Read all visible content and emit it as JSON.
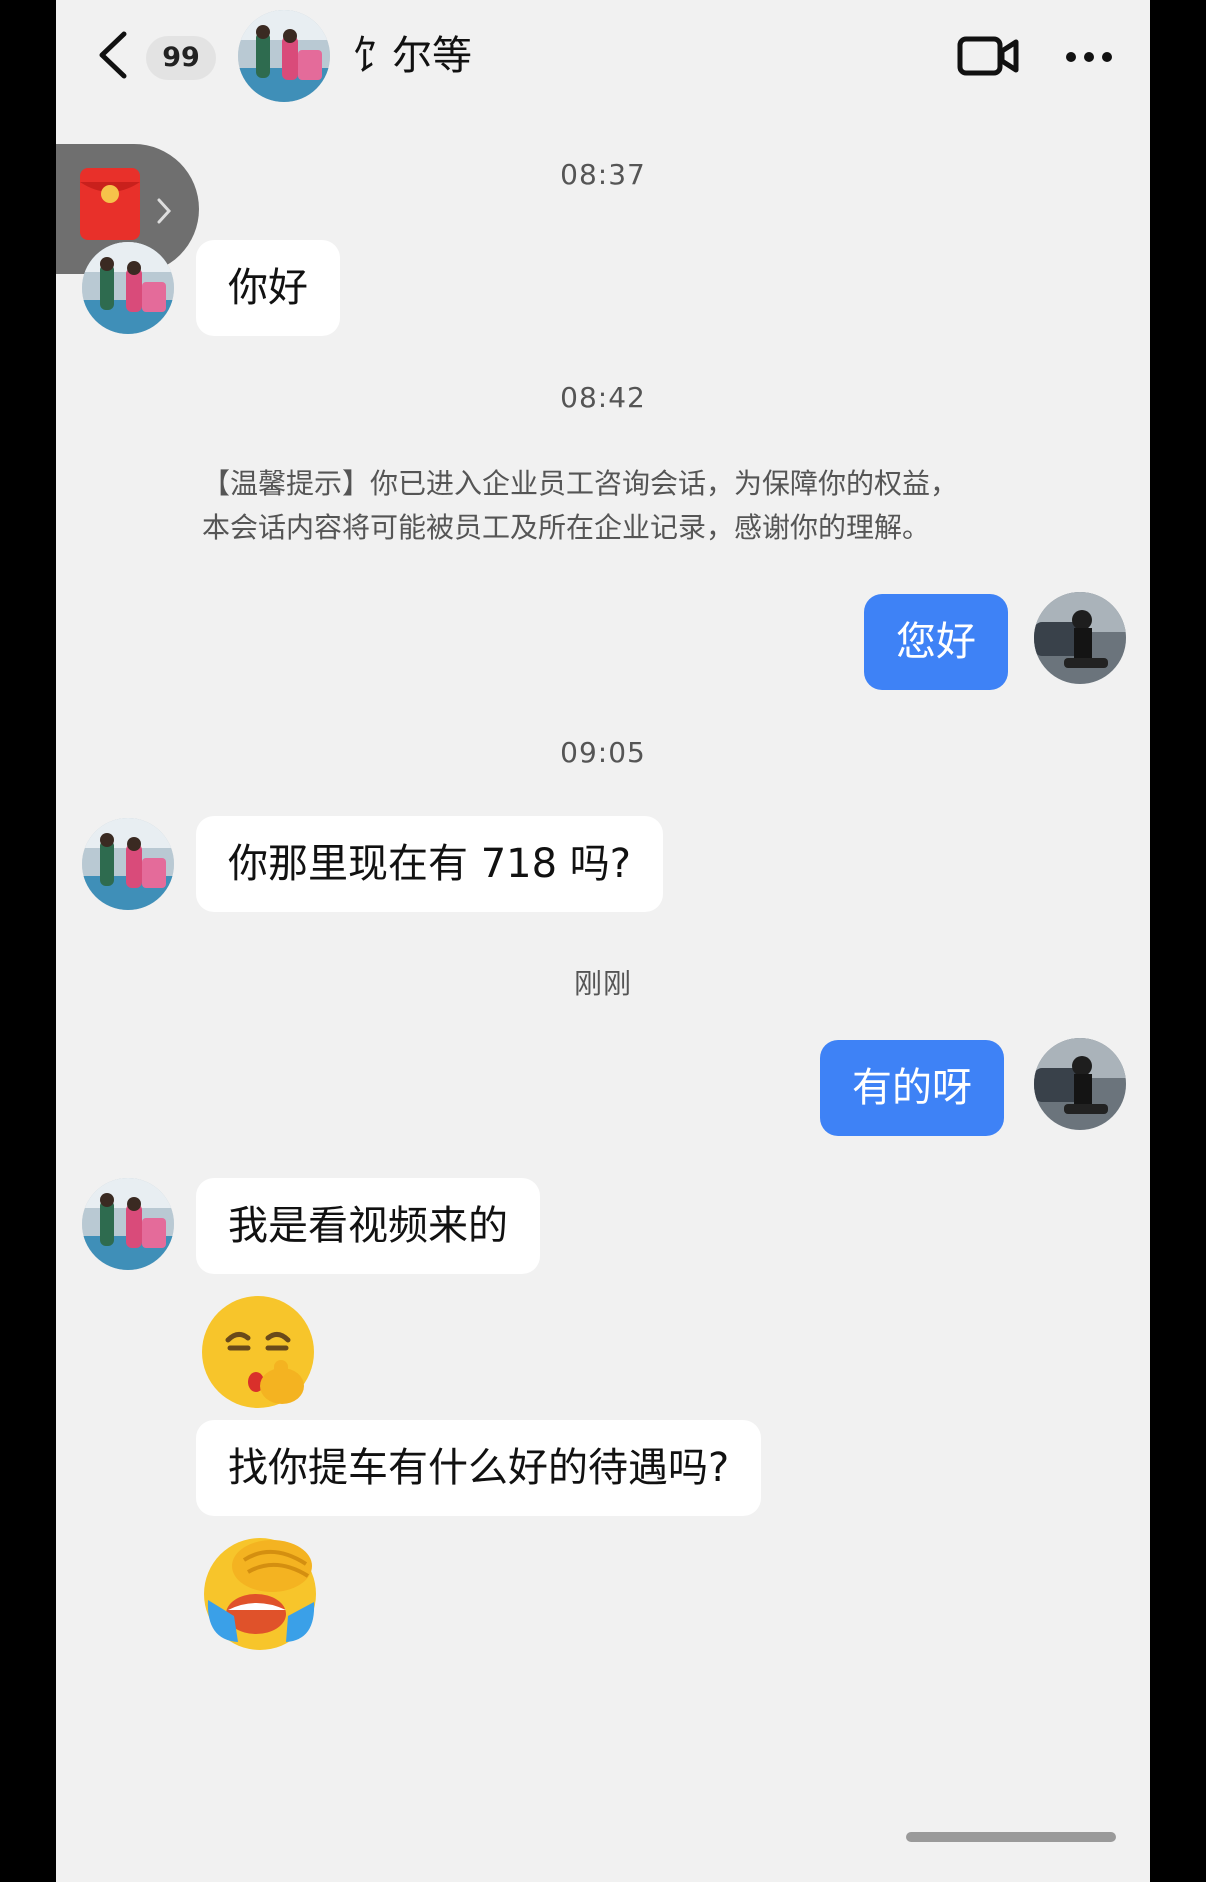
{
  "header": {
    "unread_count": "99",
    "title": "饣尔等"
  },
  "timestamps": [
    "08:37",
    "08:42",
    "09:05",
    "刚刚"
  ],
  "notice": {
    "line1": "【温馨提示】你已进入企业员工咨询会话，为保障你的权益，",
    "line2": "本会话内容将可能被员工及所在企业记录，感谢你的理解。"
  },
  "messages": [
    {
      "side": "in",
      "text": "你好"
    },
    {
      "side": "out",
      "text": "您好"
    },
    {
      "side": "in",
      "text": "你那里现在有 718 吗?"
    },
    {
      "side": "out",
      "text": "有的呀"
    },
    {
      "side": "in",
      "text": "我是看视频来的"
    },
    {
      "side": "in",
      "emoji": "shushing-thinking-emoji"
    },
    {
      "side": "in",
      "text": "找你提车有什么好的待遇吗?"
    },
    {
      "side": "in",
      "emoji": "facepalm-laughing-crying-emoji"
    }
  ],
  "colors": {
    "accent": "#3e82f6",
    "background": "#f1f1f1",
    "incoming_bubble": "#ffffff",
    "red_packet": "#e8302a"
  },
  "icons": [
    "back-icon",
    "video-call-icon",
    "more-icon",
    "red-packet-icon",
    "chevron-right-icon"
  ]
}
